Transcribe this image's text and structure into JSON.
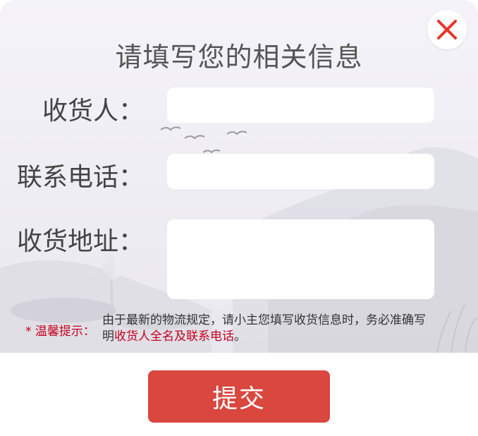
{
  "dialog": {
    "title": "请填写您的相关信息"
  },
  "form": {
    "receiver": {
      "label": "收货人：",
      "value": "",
      "placeholder": ""
    },
    "phone": {
      "label": "联系电话：",
      "value": "",
      "placeholder": ""
    },
    "address": {
      "label": "收货地址：",
      "value": "",
      "placeholder": ""
    }
  },
  "tip": {
    "label": "* 温馨提示：",
    "text_part1": "由于最新的物流规定，请小主您填写收货信息时，务必准确写明",
    "text_highlight": "收货人全名及联系电话",
    "text_part3": "。"
  },
  "actions": {
    "submit_label": "提交"
  },
  "icons": {
    "close": "close-icon"
  },
  "colors": {
    "accent_red": "#d9473f",
    "tip_red": "#c5001e",
    "close_red": "#e8352c"
  }
}
